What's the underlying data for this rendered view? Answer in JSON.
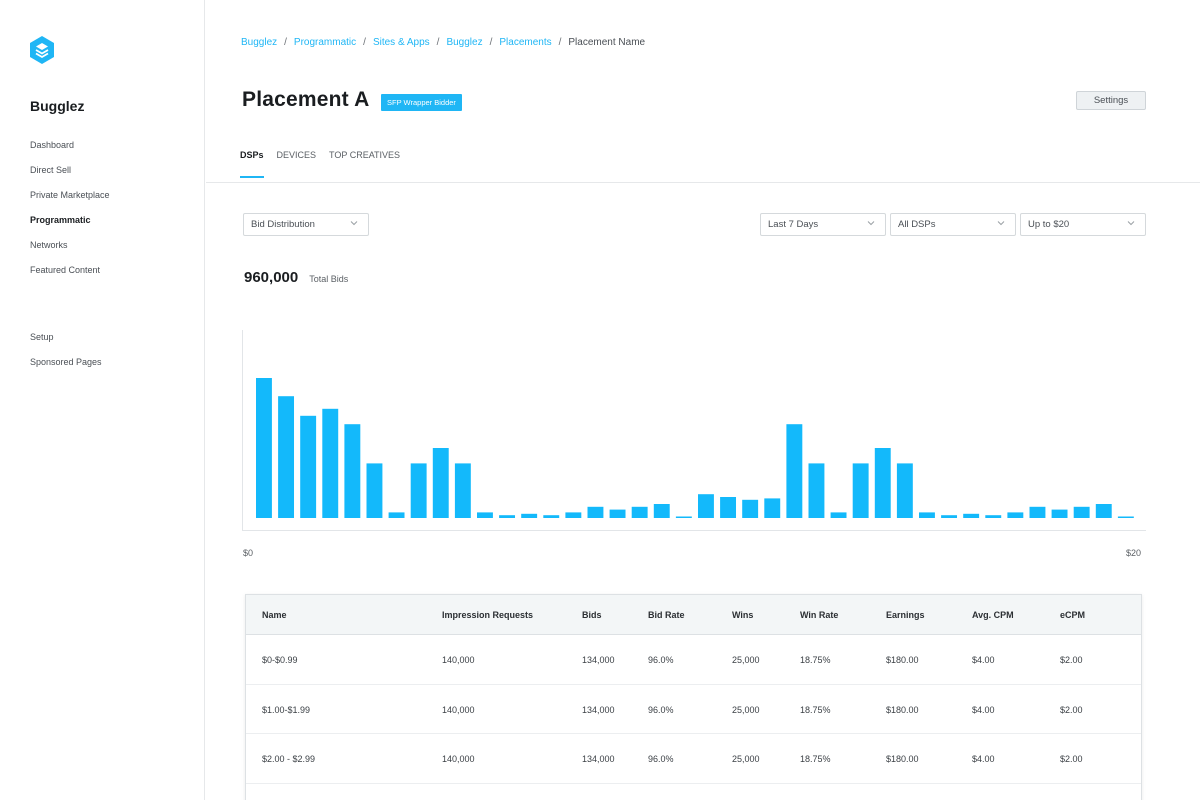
{
  "sidebar": {
    "brand": "Bugglez",
    "items": [
      {
        "label": "Dashboard",
        "active": false
      },
      {
        "label": "Direct Sell",
        "active": false
      },
      {
        "label": "Private Marketplace",
        "active": false
      },
      {
        "label": "Programmatic",
        "active": true
      },
      {
        "label": "Networks",
        "active": false
      },
      {
        "label": "Featured Content",
        "active": false
      }
    ],
    "secondary": [
      {
        "label": "Setup"
      },
      {
        "label": "Sponsored Pages"
      }
    ]
  },
  "breadcrumb": {
    "crumbs": [
      "Bugglez",
      "Programmatic",
      "Sites & Apps",
      "Bugglez",
      "Placements"
    ],
    "separator": "/",
    "current": "Placement Name"
  },
  "header": {
    "title": "Placement A",
    "badge": "SFP Wrapper Bidder",
    "settings_label": "Settings"
  },
  "tabs": [
    {
      "label": "DSPs",
      "active": true
    },
    {
      "label": "DEVICES",
      "active": false
    },
    {
      "label": "TOP CREATIVES",
      "active": false
    }
  ],
  "filters": {
    "metric": "Bid Distribution",
    "range": "Last 7 Days",
    "dsp": "All DSPs",
    "price": "Up to $20"
  },
  "summary": {
    "total_value": "960,000",
    "total_label": "Total Bids"
  },
  "colors": {
    "accent": "#1fb6f5",
    "bar": "#13b9fb"
  },
  "chart_data": {
    "type": "bar",
    "x_min_label": "$0",
    "x_max_label": "$20",
    "values": [
      100,
      87,
      73,
      78,
      67,
      39,
      4,
      39,
      50,
      39,
      4,
      2,
      3,
      2,
      4,
      8,
      6,
      8,
      10,
      1,
      17,
      15,
      13,
      14,
      67,
      39,
      4,
      39,
      50,
      39,
      4,
      2,
      3,
      2,
      4,
      8,
      6,
      8,
      10,
      1
    ],
    "grid": false
  },
  "table": {
    "columns": [
      "Name",
      "Impression Requests",
      "Bids",
      "Bid Rate",
      "Wins",
      "Win Rate",
      "Earnings",
      "Avg. CPM",
      "eCPM"
    ],
    "rows": [
      [
        "$0-$0.99",
        "140,000",
        "134,000",
        "96.0%",
        "25,000",
        "18.75%",
        "$180.00",
        "$4.00",
        "$2.00"
      ],
      [
        "$1.00-$1.99",
        "140,000",
        "134,000",
        "96.0%",
        "25,000",
        "18.75%",
        "$180.00",
        "$4.00",
        "$2.00"
      ],
      [
        "$2.00 - $2.99",
        "140,000",
        "134,000",
        "96.0%",
        "25,000",
        "18.75%",
        "$180.00",
        "$4.00",
        "$2.00"
      ]
    ]
  }
}
